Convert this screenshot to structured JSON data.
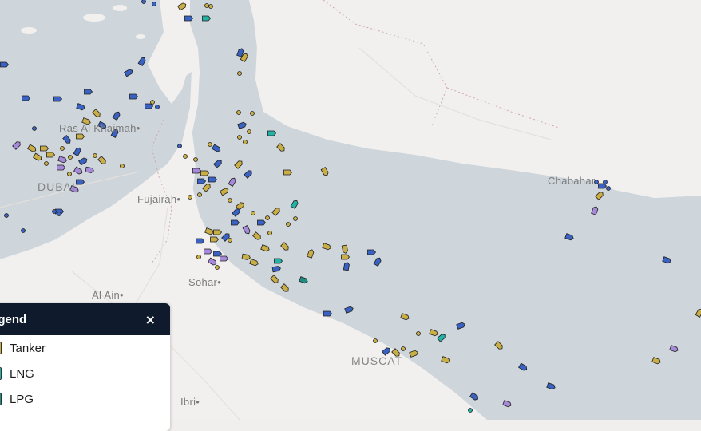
{
  "map": {
    "places": [
      {
        "id": "ras-al-khaimah",
        "text": "Ras Al Khaimah•"
      },
      {
        "id": "dubai",
        "text": "DUBAI"
      },
      {
        "id": "fujairah",
        "text": "Fujairah•"
      },
      {
        "id": "sohar",
        "text": "Sohar•"
      },
      {
        "id": "al-ain",
        "text": "Al Ain•"
      },
      {
        "id": "muscat",
        "text": "MUSCAT"
      },
      {
        "id": "ibri",
        "text": "Ibri•"
      },
      {
        "id": "chabahar",
        "text": "Chabahar"
      }
    ],
    "colors": {
      "sea": "#ced5db",
      "land": "#f1f0ef",
      "tanker": "#c9ae46",
      "lng": "#22b3a6",
      "lpg": "#1f8d80",
      "cargo": "#3a62c2",
      "passenger": "#a68ad9",
      "other": "#8a8a2a"
    }
  },
  "legend": {
    "title": "egend",
    "close_label": "×",
    "items": [
      {
        "label": "Tanker",
        "color": "#c9ae46"
      },
      {
        "label": "LNG",
        "color": "#22b3a6"
      },
      {
        "label": "LPG",
        "color": "#1f8d80"
      }
    ]
  }
}
